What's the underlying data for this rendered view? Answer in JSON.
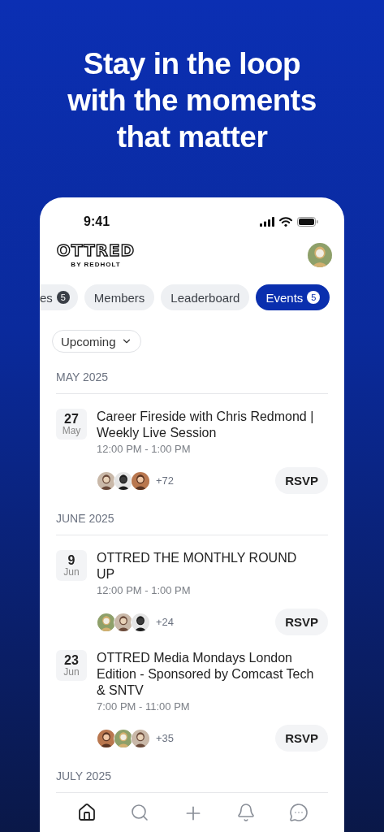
{
  "headline": "Stay in the loop\nwith the moments\nthat matter",
  "status_bar": {
    "time": "9:41"
  },
  "header": {
    "logo": "OTTRED",
    "logo_sub": "BY REDHOLT"
  },
  "tabs": [
    {
      "label": "es",
      "badge": "5",
      "selected": false
    },
    {
      "label": "Members",
      "selected": false
    },
    {
      "label": "Leaderboard",
      "selected": false
    },
    {
      "label": "Events",
      "badge": "5",
      "selected": true
    }
  ],
  "filter": {
    "label": "Upcoming"
  },
  "sections": [
    {
      "month": "MAY 2025",
      "events": [
        {
          "day": "27",
          "month": "May",
          "title": "Career Fireside with Chris Redmond | Weekly Live Session",
          "time": "12:00 PM - 1:00 PM",
          "more": "+72",
          "button": "RSVP"
        }
      ]
    },
    {
      "month": "JUNE 2025",
      "events": [
        {
          "day": "9",
          "month": "Jun",
          "title": "OTTRED THE MONTHLY ROUND UP",
          "time": "12:00 PM - 1:00 PM",
          "more": "+24",
          "button": "RSVP"
        },
        {
          "day": "23",
          "month": "Jun",
          "title": "OTTRED Media Mondays London Edition - Sponsored by Comcast Tech & SNTV",
          "time": "7:00 PM - 11:00 PM",
          "more": "+35",
          "button": "RSVP"
        }
      ]
    },
    {
      "month": "JULY 2025"
    }
  ],
  "nav": [
    {
      "kind": "home",
      "selected": true
    },
    {
      "kind": "search",
      "selected": false
    },
    {
      "kind": "add",
      "selected": false
    },
    {
      "kind": "notifications",
      "selected": false
    },
    {
      "kind": "messages",
      "selected": false
    }
  ]
}
